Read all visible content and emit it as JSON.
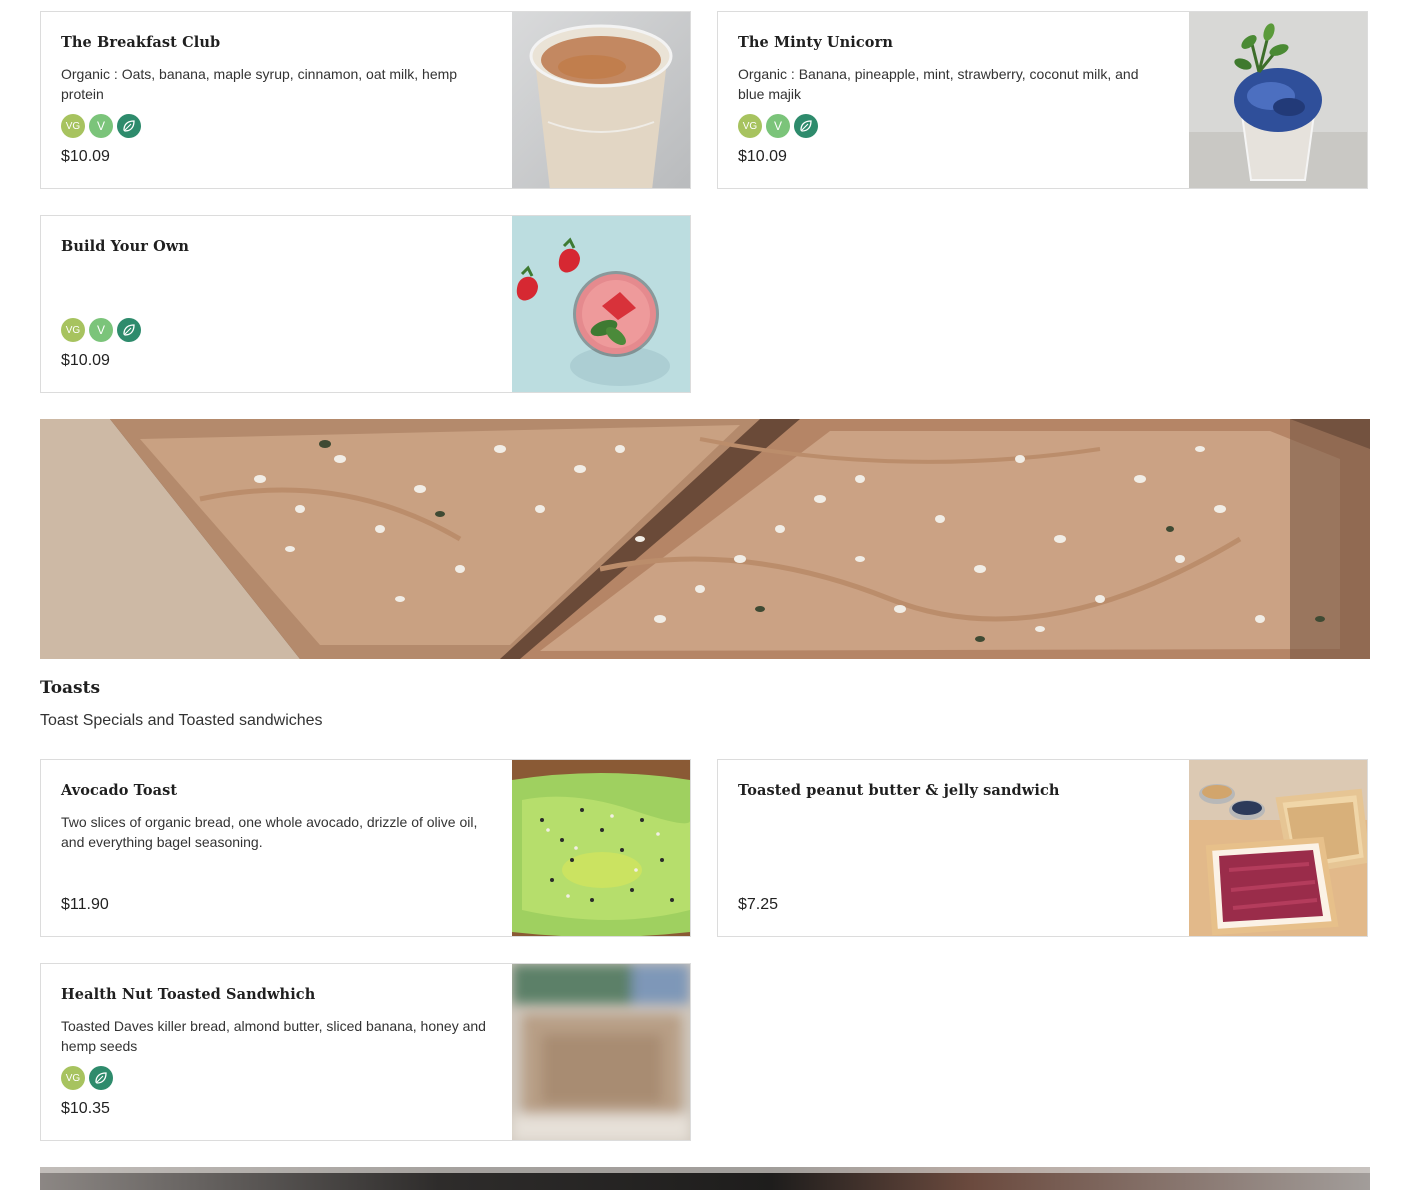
{
  "smoothies": [
    {
      "title": "The Breakfast Club",
      "desc": "Organic : Oats, banana, maple syrup, cinnamon, oat milk, hemp protein",
      "badges": [
        "VG",
        "V",
        "leaf"
      ],
      "price": "$10.09"
    },
    {
      "title": "The Minty Unicorn",
      "desc": "Organic : Banana, pineapple, mint, strawberry, coconut milk, and blue majik",
      "badges": [
        "VG",
        "V",
        "leaf"
      ],
      "price": "$10.09"
    },
    {
      "title": "Build Your Own",
      "desc": "",
      "badges": [
        "VG",
        "V",
        "leaf"
      ],
      "price": "$10.09"
    }
  ],
  "toasts_section": {
    "title": "Toasts",
    "description": "Toast Specials and Toasted sandwiches"
  },
  "toasts": [
    {
      "title": "Avocado Toast",
      "desc": "Two slices of organic bread, one whole avocado, drizzle of olive oil, and everything bagel seasoning.",
      "price": "$11.90"
    },
    {
      "title": "Toasted peanut butter & jelly sandwich",
      "desc": "",
      "price": "$7.25"
    },
    {
      "title": "Health Nut Toasted Sandwhich",
      "desc": "Toasted Daves killer bread, almond butter, sliced banana, honey and hemp seeds",
      "badges": [
        "VG",
        "leaf"
      ],
      "price": "$10.35"
    }
  ],
  "badge_labels": {
    "vg": "VG",
    "v": "V"
  },
  "colors": {
    "vg_badge": "#a7c35f",
    "v_badge": "#7bc47a",
    "leaf_badge": "#2e8b6c",
    "card_border": "#dcdcdc"
  }
}
